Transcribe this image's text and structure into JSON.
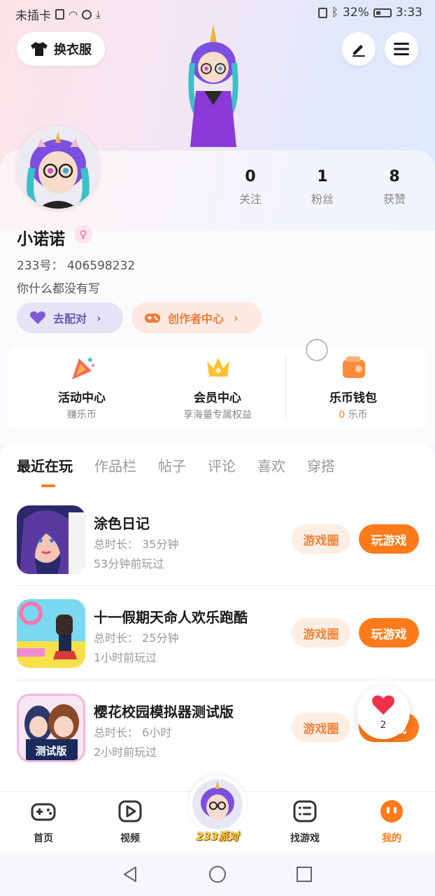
{
  "status_bar": {
    "carrier": "未插卡",
    "battery": "32%",
    "time": "3:33"
  },
  "header": {
    "outfit_label": "换衣服"
  },
  "profile": {
    "name": "小诺诺",
    "id_text": "233号： 406598232",
    "bio": "你什么都没有写",
    "stats": [
      {
        "value": "0",
        "label": "关注"
      },
      {
        "value": "1",
        "label": "粉丝"
      },
      {
        "value": "8",
        "label": "获赞"
      }
    ],
    "match_label": "去配对",
    "creator_label": "创作者中心"
  },
  "features": [
    {
      "title": "活动中心",
      "sub": "赚乐币",
      "icon": "party-icon"
    },
    {
      "title": "会员中心",
      "sub": "享海量专属权益",
      "icon": "crown-icon"
    },
    {
      "title": "乐币钱包",
      "sub_value": "0",
      "sub_unit": "乐币",
      "icon": "wallet-icon"
    }
  ],
  "tabs": [
    "最近在玩",
    "作品栏",
    "帖子",
    "评论",
    "喜欢",
    "穿搭"
  ],
  "games": [
    {
      "name": "涂色日记",
      "duration": "总时长：  35分钟",
      "last": "53分钟前玩过"
    },
    {
      "name": "十一假期天命人欢乐跑酷",
      "duration": "总时长：  25分钟",
      "last": "1小时前玩过"
    },
    {
      "name": "樱花校园模拟器测试版",
      "duration": "总时长：  6小时",
      "last": "2小时前玩过",
      "badge": "测试版"
    }
  ],
  "game_buttons": {
    "circle": "游戏圈",
    "play": "玩游戏"
  },
  "like_count": "2",
  "bottom_nav": [
    {
      "label": "首页",
      "icon": "gamepad-icon"
    },
    {
      "label": "视频",
      "icon": "video-icon"
    },
    {
      "label": "233派对",
      "icon": "party-avatar-icon"
    },
    {
      "label": "找游戏",
      "icon": "list-icon"
    },
    {
      "label": "我的",
      "icon": "me-icon"
    }
  ],
  "colors": {
    "accent": "#ff7a1a",
    "match": "#6a5ab5",
    "creator": "#f07a3a"
  }
}
